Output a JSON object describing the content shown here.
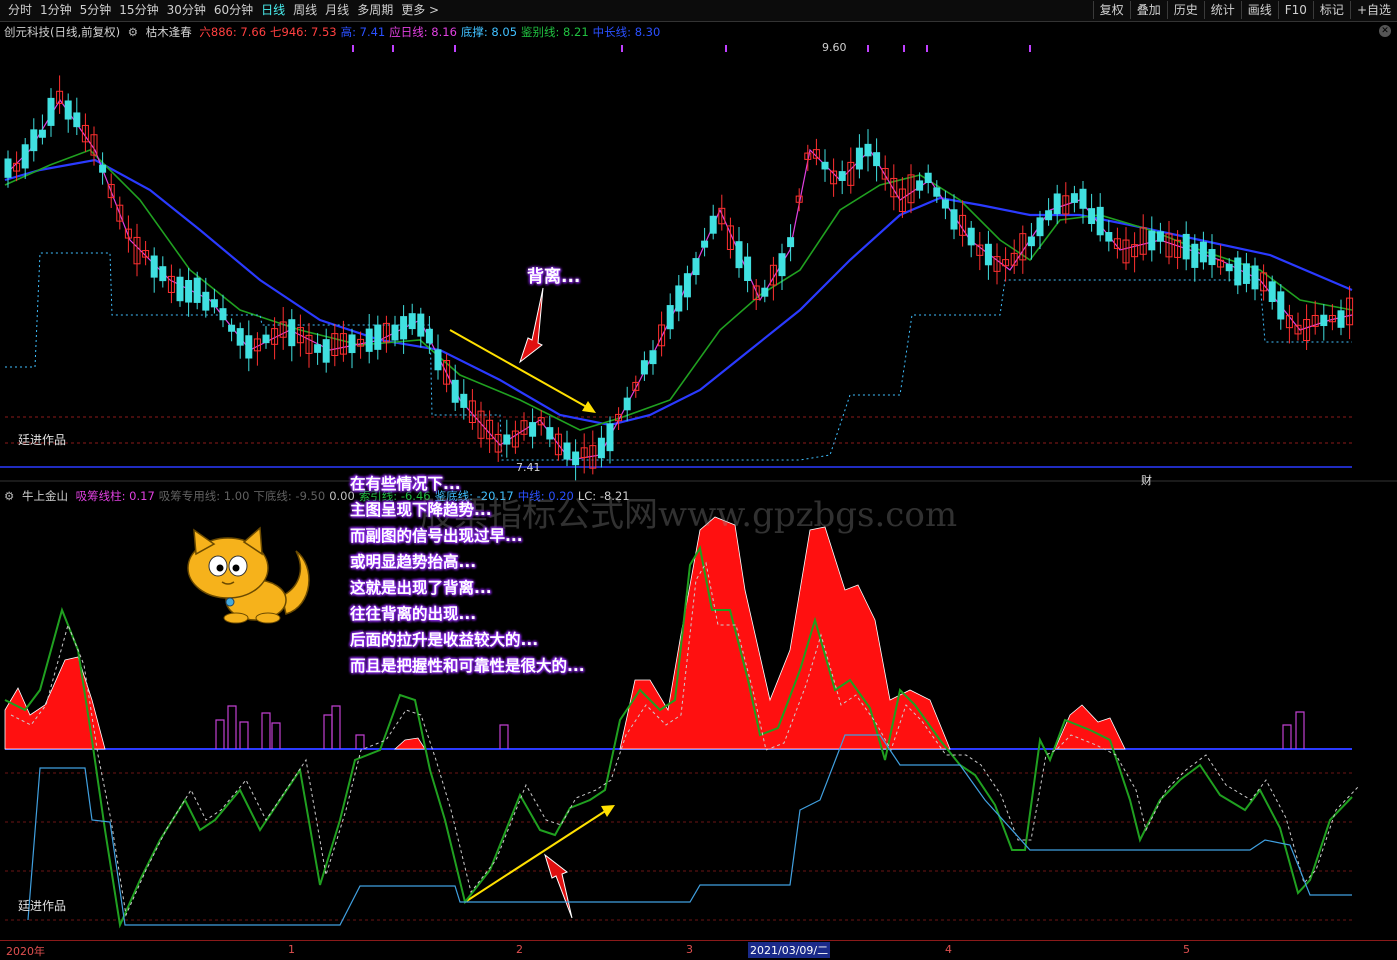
{
  "toolbar": {
    "periods": [
      "分时",
      "1分钟",
      "5分钟",
      "15分钟",
      "30分钟",
      "60分钟",
      "日线",
      "周线",
      "月线",
      "多周期",
      "更多 >"
    ],
    "active": "日线",
    "right_buttons": [
      "复权",
      "叠加",
      "历史",
      "统计",
      "画线",
      "F10",
      "标记",
      "+自选"
    ]
  },
  "main_legend": {
    "stock": "创元科技(日线,前复权)",
    "indicator": "枯木逢春",
    "items": [
      {
        "label": "六886: 7.66",
        "color": "#ff4040"
      },
      {
        "label": "七946: 7.53",
        "color": "#ff4040"
      },
      {
        "label": "高: 7.41",
        "color": "#2a50ff"
      },
      {
        "label": "应日线: 8.16",
        "color": "#e040e0"
      },
      {
        "label": "底撑: 8.05",
        "color": "#40c0ff"
      },
      {
        "label": "鉴别线: 8.21",
        "color": "#20c040"
      },
      {
        "label": "中长线: 8.30",
        "color": "#2a50ff"
      }
    ],
    "high_label": "9.60",
    "low_label": "7.41",
    "author_tag": "廷进作品",
    "marker": "财"
  },
  "sub_legend": {
    "indicator": "牛上金山",
    "items": [
      {
        "label": "吸筹线柱: 0.17",
        "color": "#e040e0"
      },
      {
        "label": "吸筹专用线: 1.00",
        "color": "#606060"
      },
      {
        "label": "下底线: -9.50",
        "color": "#606060"
      },
      {
        "label": "0.00",
        "color": "#c0c0c0"
      },
      {
        "label": "索引线: -6.46",
        "color": "#20c040"
      },
      {
        "label": "鉴底线: -20.17",
        "color": "#40c0ff"
      },
      {
        "label": "中线: 0.20",
        "color": "#2a50ff"
      },
      {
        "label": "LC: -8.21",
        "color": "#d0d0d0"
      }
    ],
    "author_tag": "廷进作品"
  },
  "annotations": {
    "callout": "背离...",
    "lines": [
      "在有些情况下...",
      "主图呈现下降趋势...",
      "而副图的信号出现过早...",
      "或明显趋势抬高...",
      "这就是出现了背离...",
      "往往背离的出现...",
      "后面的拉升是收益较大的...",
      "而且是把握性和可靠性是很大的..."
    ]
  },
  "watermark": "股票指标公式网www.gpzbgs.com",
  "datebar": {
    "ticks": [
      {
        "label": "2020年"
      },
      {
        "label": "1"
      },
      {
        "label": "2"
      },
      {
        "label": "3"
      },
      {
        "label": "4"
      },
      {
        "label": "5"
      }
    ],
    "cursor_date": "2021/03/09/二"
  },
  "colors": {
    "up": "#ff3030",
    "down": "#40e0e0",
    "ma_green": "#20a020",
    "ma_blue": "#2a3aff",
    "ma_pink": "#e040e0",
    "support": "#40c0ff",
    "fill_red": "#ff1010"
  }
}
